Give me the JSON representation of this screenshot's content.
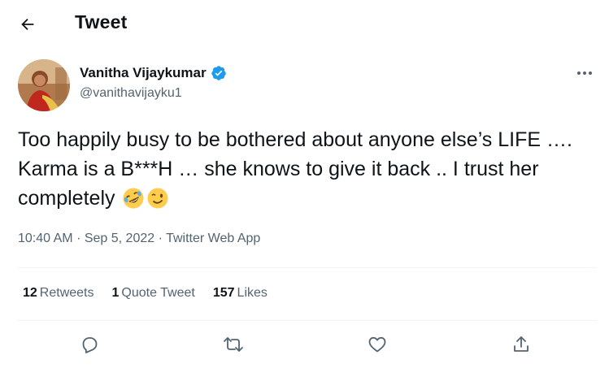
{
  "header": {
    "back_icon": "arrow-left-icon",
    "title": "Tweet"
  },
  "author": {
    "name": "Vanitha Vijaykumar",
    "handle": "@vanithavijayku1",
    "verified_icon": "verified-badge-icon",
    "verified_color": "#1d9bf0"
  },
  "tweet": {
    "text": "Too happily busy to be bothered about anyone else’s LIFE …. Karma is a B***H … she knows to give it back .. I trust her completely",
    "emojis": [
      "rolling-on-floor-laughing-emoji",
      "winking-face-emoji"
    ]
  },
  "meta": {
    "time": "10:40 AM",
    "separator": "·",
    "date": "Sep 5, 2022",
    "source": "Twitter Web App"
  },
  "stats": {
    "retweets_count": "12",
    "retweets_label": "Retweets",
    "quotes_count": "1",
    "quotes_label": "Quote Tweet",
    "likes_count": "157",
    "likes_label": "Likes"
  },
  "actions": [
    "reply-icon",
    "retweet-icon",
    "like-icon",
    "share-icon"
  ],
  "colors": {
    "text_primary": "#0f1419",
    "text_secondary": "#536471",
    "divider": "#eff3f4"
  }
}
